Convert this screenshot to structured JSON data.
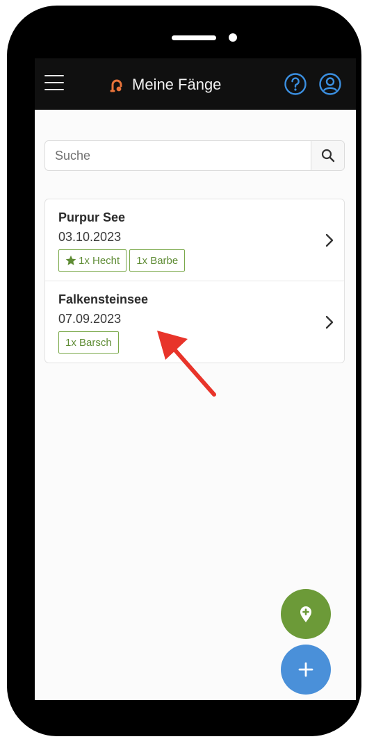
{
  "app_bar": {
    "title": "Meine Fänge",
    "icons": {
      "menu": "hamburger-menu-icon",
      "brand": "fishing-hook-icon",
      "help": "help-circle-icon",
      "account": "user-account-icon"
    },
    "colors": {
      "background": "#101010",
      "brand": "#e8733a",
      "help": "#3b8fe0",
      "account": "#3b8fe0"
    }
  },
  "search": {
    "placeholder": "Suche",
    "value": "",
    "icon": "search-icon"
  },
  "catches": [
    {
      "name": "Purpur See",
      "date": "03.10.2023",
      "tags": [
        {
          "label": "1x Hecht",
          "starred": true
        },
        {
          "label": "1x Barbe",
          "starred": false
        }
      ]
    },
    {
      "name": "Falkensteinsee",
      "date": "07.09.2023",
      "tags": [
        {
          "label": "1x Barsch",
          "starred": false
        }
      ]
    }
  ],
  "fabs": {
    "add_location": {
      "icon": "location-plus-icon",
      "color": "#6c9a38"
    },
    "add_catch": {
      "icon": "plus-icon",
      "color": "#4a90d9"
    }
  },
  "annotation": {
    "color": "#e8342a",
    "icon": "red-arrow-icon"
  },
  "colors": {
    "tag_border": "#7aa84a",
    "tag_text": "#5f8c35"
  }
}
